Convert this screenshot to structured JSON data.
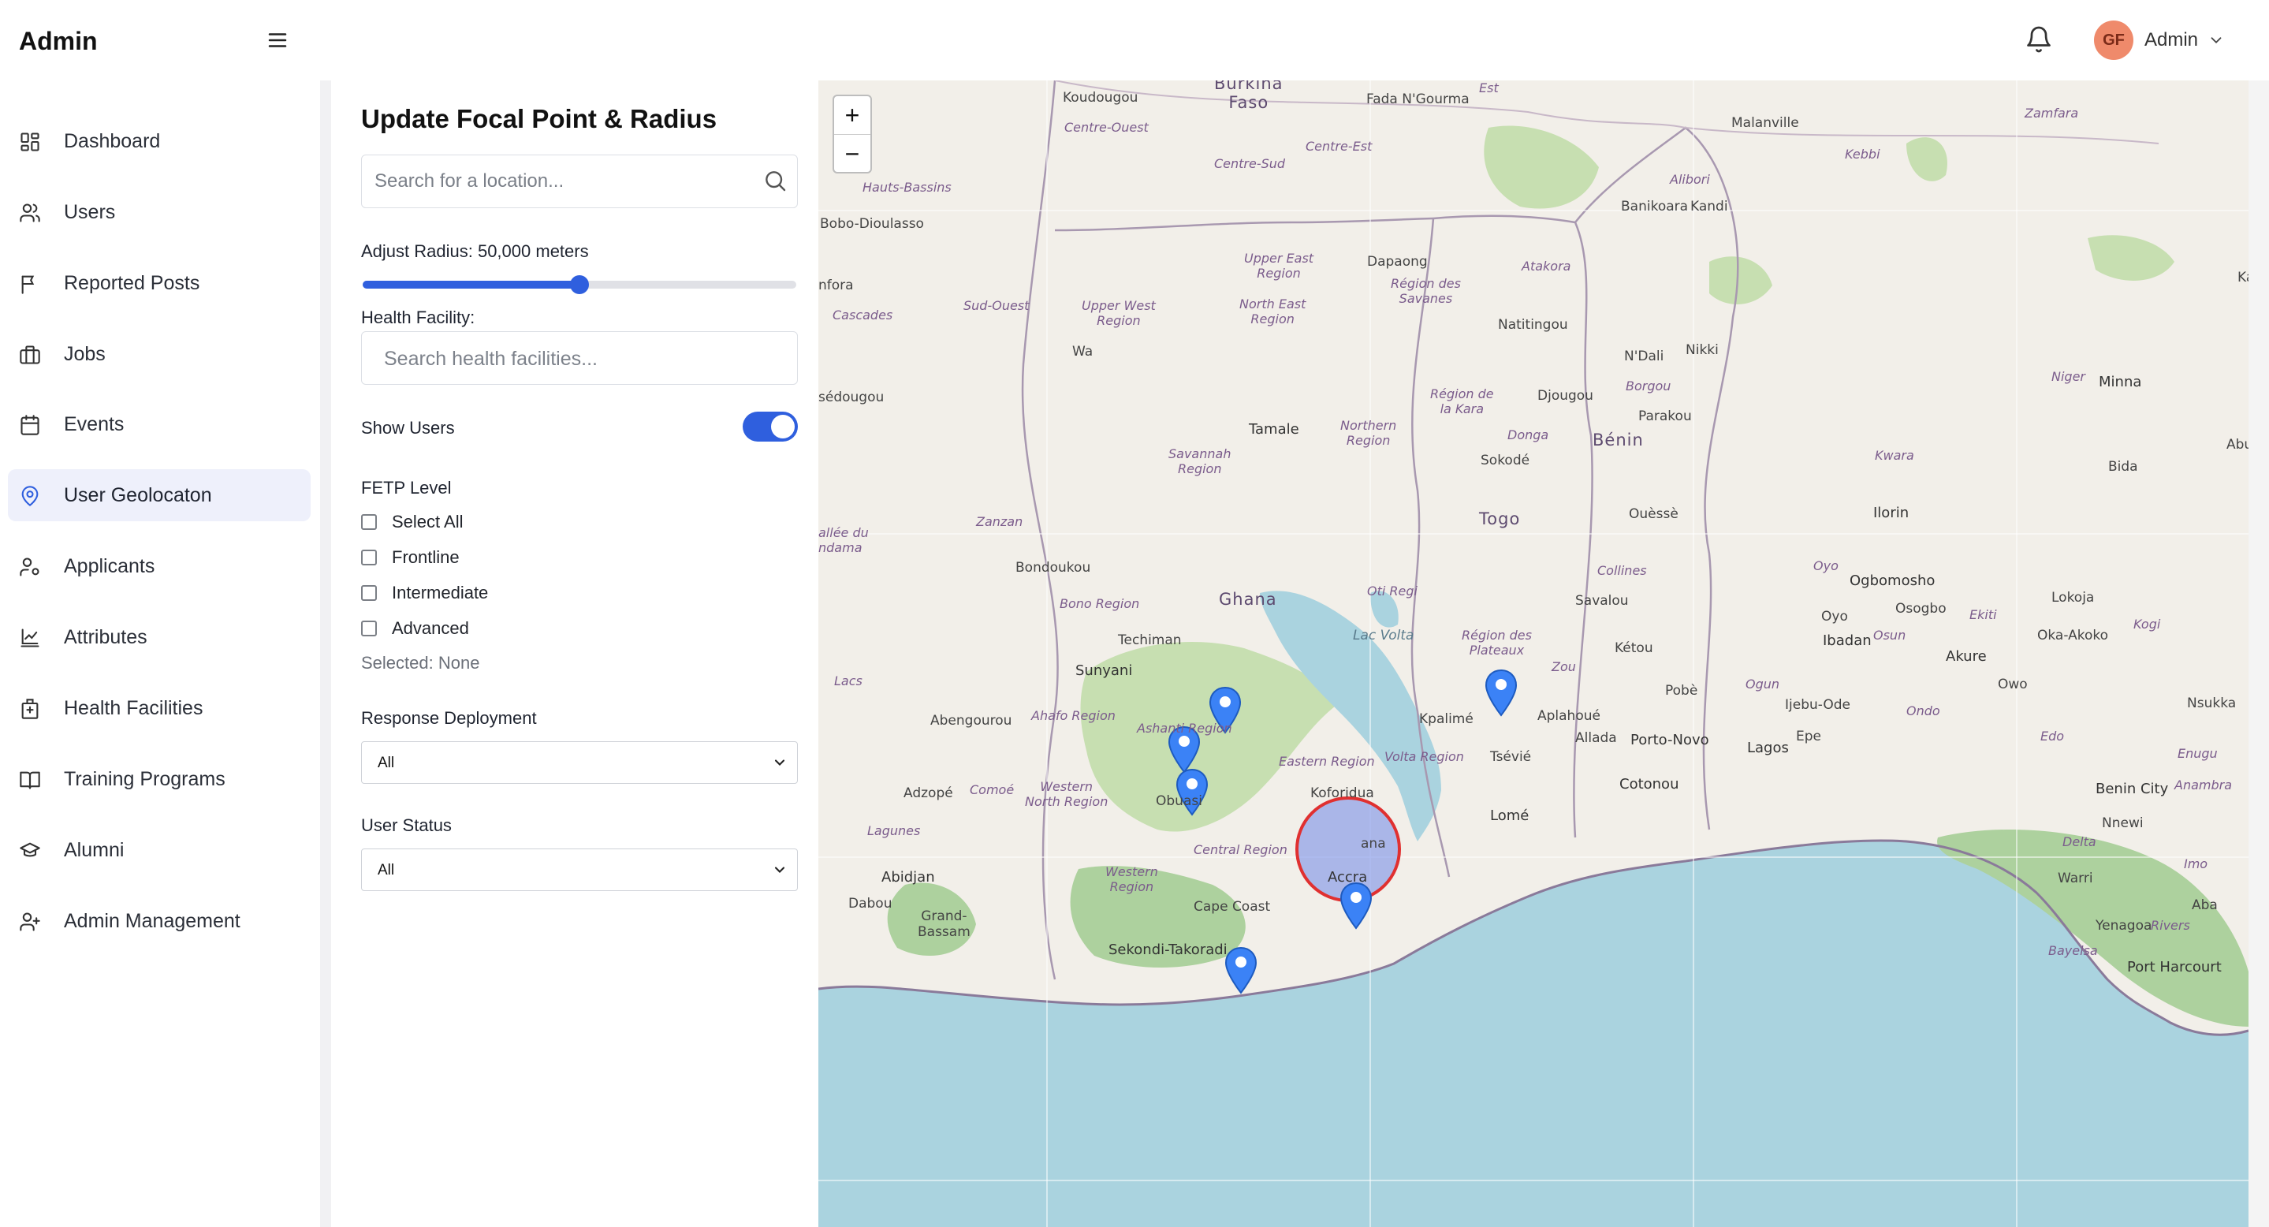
{
  "header": {
    "brand": "Admin",
    "user_initials": "GF",
    "user_name": "Admin"
  },
  "sidebar": {
    "items": [
      {
        "label": "Dashboard",
        "icon": "grid-icon"
      },
      {
        "label": "Users",
        "icon": "users-icon"
      },
      {
        "label": "Reported Posts",
        "icon": "flag-icon"
      },
      {
        "label": "Jobs",
        "icon": "briefcase-icon"
      },
      {
        "label": "Events",
        "icon": "calendar-icon"
      },
      {
        "label": "User Geolocaton",
        "icon": "map-pin-icon",
        "active": true
      },
      {
        "label": "Applicants",
        "icon": "user-cog-icon"
      },
      {
        "label": "Attributes",
        "icon": "chart-box-icon"
      },
      {
        "label": "Health Facilities",
        "icon": "hospital-icon"
      },
      {
        "label": "Training Programs",
        "icon": "book-open-icon"
      },
      {
        "label": "Alumni",
        "icon": "graduation-cap-icon"
      },
      {
        "label": "Admin Management",
        "icon": "user-plus-icon"
      }
    ]
  },
  "panel": {
    "title": "Update Focal Point & Radius",
    "search_placeholder": "Search for a location...",
    "radius_label": "Adjust Radius: 50,000 meters",
    "radius_fraction": 0.5,
    "facility_label": "Health Facility:",
    "facility_placeholder": "Search health facilities...",
    "show_users_label": "Show Users",
    "show_users_on": true,
    "fetp_label": "FETP Level",
    "fetp_options": [
      "Select All",
      "Frontline",
      "Intermediate",
      "Advanced"
    ],
    "selected_text": "Selected: None",
    "response_label": "Response Deployment",
    "response_value": "All",
    "status_label": "User Status",
    "status_value": "All"
  },
  "map": {
    "zoom_in": "+",
    "zoom_out": "−",
    "labels": {
      "burkina_faso": "Burkina\nFaso",
      "koudougou": "Koudougou",
      "fada": "Fada N'Gourma",
      "est": "Est",
      "zamfara": "Zamfara",
      "malanville": "Malanville",
      "kebbi": "Kebbi",
      "centre_ouest": "Centre-Ouest",
      "centre_est": "Centre-Est",
      "centre_sud": "Centre-Sud",
      "hauts_bassins": "Hauts-Bassins",
      "bobo": "Bobo-Dioulasso",
      "alibori": "Alibori",
      "banikoara": "Banikoara",
      "kandi": "Kandi",
      "kaduna": "Kadun",
      "upper_east": "Upper East\nRegion",
      "dapaong": "Dapaong",
      "region_savanes": "Région des\nSavanes",
      "atakora": "Atakora",
      "sud_ouest": "Sud-Ouest",
      "upper_west": "Upper West\nRegion",
      "north_east": "North East\nRegion",
      "natitingou": "Natitingou",
      "cascades": "Cascades",
      "wa": "Wa",
      "ndali": "N'Dali",
      "nikki": "Nikki",
      "borgou": "Borgou",
      "niger": "Niger",
      "minna": "Minna",
      "region_kara": "Région de\nla Kara",
      "djougou": "Djougou",
      "parakou": "Parakou",
      "tamale": "Tamale",
      "northern": "Northern\nRegion",
      "donga": "Donga",
      "benin": "Bénin",
      "abuja": "Abuj",
      "savannah": "Savannah\nRegion",
      "sokode": "Sokodé",
      "kwara": "Kwara",
      "bida": "Bida",
      "togo": "Togo",
      "ouesse": "Ouèssè",
      "ilorin": "Ilorin",
      "zanzan": "Zanzan",
      "bondoukou": "Bondoukou",
      "collines": "Collines",
      "oyo_region": "Oyo",
      "ogbomosho": "Ogbomosho",
      "savalou": "Savalou",
      "osogbo": "Osogbo",
      "ekiti": "Ekiti",
      "lokoja": "Lokoja",
      "bono": "Bono Region",
      "ghana": "Ghana",
      "oti": "Oti Regi",
      "lake_volta": "Lac Volta",
      "region_plateaux": "Région des\nPlateaux",
      "oyo": "Oyo",
      "ibadan": "Ibadan",
      "osun": "Osun",
      "oka": "Oka-Akoko",
      "kogi": "Kogi",
      "techiman": "Techiman",
      "sunyani": "Sunyani",
      "ketou": "Kétou",
      "zou": "Zou",
      "akure": "Akure",
      "owo": "Owo",
      "ogun": "Ogun",
      "pobe": "Pobè",
      "ijebu": "Ijebu-Ode",
      "ondo": "Ondo",
      "nsukka": "Nsukka",
      "ahafo": "Ahafo Region",
      "ashanti": "Ashanti Region",
      "abengourou": "Abengourou",
      "kpalime": "Kpalimé",
      "aplahoue": "Aplahoué",
      "allada": "Allada",
      "porto_novo": "Porto-Novo",
      "lagos": "Lagos",
      "epe": "Epe",
      "edo": "Edo",
      "enugu": "Enugu",
      "eastern": "Eastern Region",
      "volta": "Volta Region",
      "tsevie": "Tsévié",
      "cotonou": "Cotonou",
      "adzope": "Adzopé",
      "comoe": "Comoé",
      "western_north": "Western\nNorth Region",
      "obuasi": "Obuasi",
      "koforidua": "Koforidua",
      "benin_city": "Benin City",
      "anambra": "Anambra",
      "lome": "Lomé",
      "lagunes": "Lagunes",
      "central": "Central Region",
      "accra_region": "ana",
      "nnewi": "Nnewi",
      "delta": "Delta",
      "abidjan": "Abidjan",
      "western": "Western\nRegion",
      "accra": "Accra",
      "warri": "Warri",
      "imo": "Imo",
      "dabou": "Dabou",
      "cape_coast": "Cape Coast",
      "aba": "Aba",
      "grand_bassam": "Grand-\nBassam",
      "yenagoa": "Yenagoa",
      "rivers": "Rivers",
      "sekondi": "Sekondi-Takoradi",
      "bayelsa": "Bayelsa",
      "port_harcourt": "Port Harcourt",
      "sedougou": "sédougou",
      "nfora": "nfora",
      "valle": "allée du\nndama",
      "locs": "Lacs"
    }
  },
  "colors": {
    "accent": "#2f5fde",
    "active_nav_bg": "#eef0fb",
    "avatar_bg": "#ef8a6b",
    "water": "#aad3df",
    "land": "#f2efe9",
    "forest": "#add19e",
    "radius_fill": "#6f86e8",
    "radius_stroke": "#e03030",
    "pin": "#3b82f6"
  }
}
